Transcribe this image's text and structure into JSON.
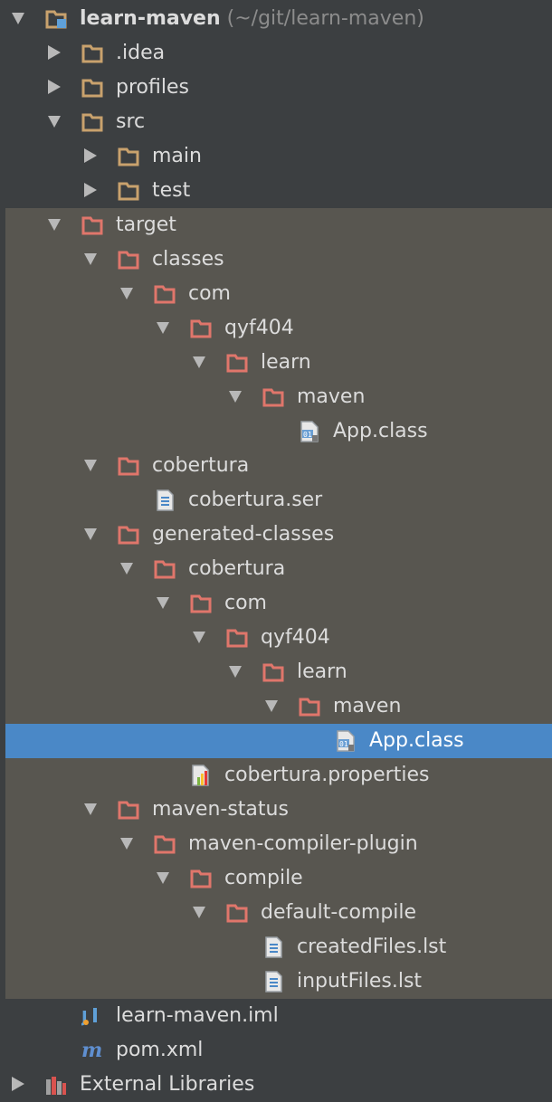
{
  "colors": {
    "background": "#3c3f41",
    "excluded_band": "#585650",
    "selection": "#4a88c7",
    "folder_normal": "#c9a26d",
    "folder_excluded": "#e0766b",
    "text": "#dcdcdc"
  },
  "project": {
    "name": "learn-maven",
    "path_hint": "(~/git/learn-maven)"
  },
  "tree": [
    {
      "label": ".idea",
      "indent": 2,
      "arrow": "collapsed",
      "icon": "folder-icon"
    },
    {
      "label": "profiles",
      "indent": 2,
      "arrow": "collapsed",
      "icon": "folder-icon"
    },
    {
      "label": "src",
      "indent": 2,
      "arrow": "expanded",
      "icon": "folder-icon"
    },
    {
      "label": "main",
      "indent": 3,
      "arrow": "collapsed",
      "icon": "folder-icon"
    },
    {
      "label": "test",
      "indent": 3,
      "arrow": "collapsed",
      "icon": "folder-icon"
    },
    {
      "label": "target",
      "indent": 2,
      "arrow": "expanded",
      "icon": "excluded-folder-icon"
    },
    {
      "label": "classes",
      "indent": 3,
      "arrow": "expanded",
      "icon": "excluded-folder-icon"
    },
    {
      "label": "com",
      "indent": 4,
      "arrow": "expanded",
      "icon": "excluded-folder-icon"
    },
    {
      "label": "qyf404",
      "indent": 5,
      "arrow": "expanded",
      "icon": "excluded-folder-icon"
    },
    {
      "label": "learn",
      "indent": 6,
      "arrow": "expanded",
      "icon": "excluded-folder-icon"
    },
    {
      "label": "maven",
      "indent": 7,
      "arrow": "expanded",
      "icon": "excluded-folder-icon"
    },
    {
      "label": "App.class",
      "indent": 8,
      "arrow": "none",
      "icon": "class-file-icon"
    },
    {
      "label": "cobertura",
      "indent": 3,
      "arrow": "expanded",
      "icon": "excluded-folder-icon"
    },
    {
      "label": "cobertura.ser",
      "indent": 4,
      "arrow": "none",
      "icon": "text-file-icon"
    },
    {
      "label": "generated-classes",
      "indent": 3,
      "arrow": "expanded",
      "icon": "excluded-folder-icon"
    },
    {
      "label": "cobertura",
      "indent": 4,
      "arrow": "expanded",
      "icon": "excluded-folder-icon"
    },
    {
      "label": "com",
      "indent": 5,
      "arrow": "expanded",
      "icon": "excluded-folder-icon"
    },
    {
      "label": "qyf404",
      "indent": 6,
      "arrow": "expanded",
      "icon": "excluded-folder-icon"
    },
    {
      "label": "learn",
      "indent": 7,
      "arrow": "expanded",
      "icon": "excluded-folder-icon"
    },
    {
      "label": "maven",
      "indent": 8,
      "arrow": "expanded",
      "icon": "excluded-folder-icon"
    },
    {
      "label": "App.class",
      "indent": 9,
      "arrow": "none",
      "icon": "class-file-icon",
      "selected": true
    },
    {
      "label": "cobertura.properties",
      "indent": 5,
      "arrow": "none",
      "icon": "properties-file-icon"
    },
    {
      "label": "maven-status",
      "indent": 3,
      "arrow": "expanded",
      "icon": "excluded-folder-icon"
    },
    {
      "label": "maven-compiler-plugin",
      "indent": 4,
      "arrow": "expanded",
      "icon": "excluded-folder-icon"
    },
    {
      "label": "compile",
      "indent": 5,
      "arrow": "expanded",
      "icon": "excluded-folder-icon"
    },
    {
      "label": "default-compile",
      "indent": 6,
      "arrow": "expanded",
      "icon": "excluded-folder-icon"
    },
    {
      "label": "createdFiles.lst",
      "indent": 7,
      "arrow": "none",
      "icon": "text-file-icon"
    },
    {
      "label": "inputFiles.lst",
      "indent": 7,
      "arrow": "none",
      "icon": "text-file-icon"
    },
    {
      "label": "learn-maven.iml",
      "indent": 2,
      "arrow": "none",
      "icon": "iml-file-icon"
    },
    {
      "label": "pom.xml",
      "indent": 2,
      "arrow": "none",
      "icon": "maven-pom-icon"
    },
    {
      "label": "External Libraries",
      "indent": 1,
      "arrow": "collapsed",
      "icon": "external-libraries-icon"
    }
  ]
}
